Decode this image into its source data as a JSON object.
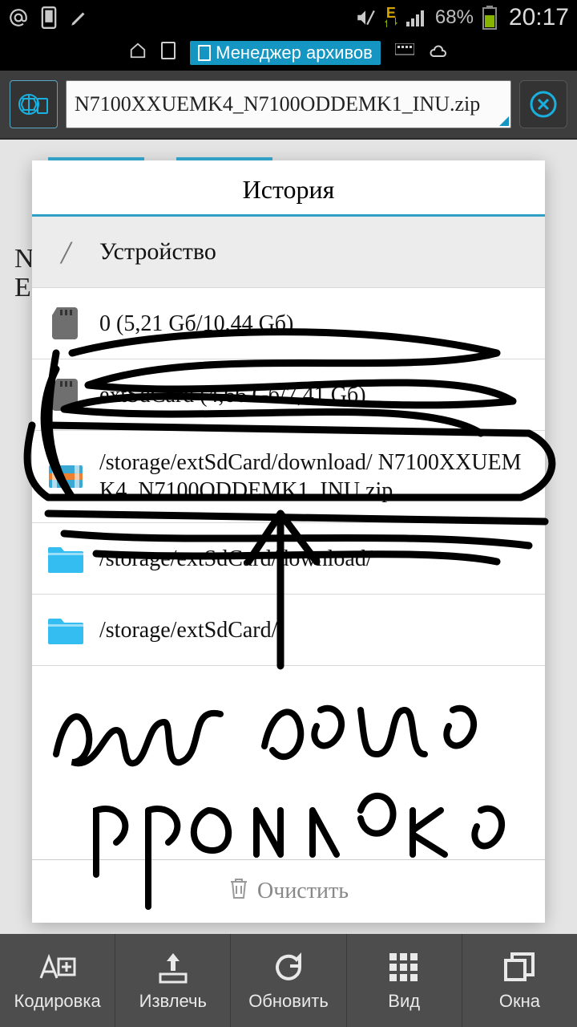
{
  "status": {
    "battery_pct": "68%",
    "clock": "20:17",
    "network_label": "E"
  },
  "taskbar": {
    "app_name": "Менеджер архивов"
  },
  "address": {
    "path": "N7100XXUEMK4_N7100ODDEMK1_INU.zip"
  },
  "bg_text": "N\nE",
  "dialog": {
    "title": "История",
    "device_header": "Устройство",
    "rows": [
      {
        "kind": "sd",
        "label": "0 (5,21 Gб/10,44 Gб)"
      },
      {
        "kind": "sd",
        "label": "extSdCard (4,66 Gб/7,41 Gб)"
      },
      {
        "kind": "archive",
        "label": "/storage/extSdCard/download/ N7100XXUEMK4_N7100ODDEMK1_INU.zip"
      },
      {
        "kind": "folder",
        "label": "/storage/extSdCard/download/"
      },
      {
        "kind": "folder",
        "label": "/storage/extSdCard/"
      }
    ],
    "clear": "Очистить"
  },
  "nav": {
    "items": [
      "Кодировка",
      "Извлечь",
      "Обновить",
      "Вид",
      "Окна"
    ]
  },
  "handwriting": "вот сама прошивка"
}
